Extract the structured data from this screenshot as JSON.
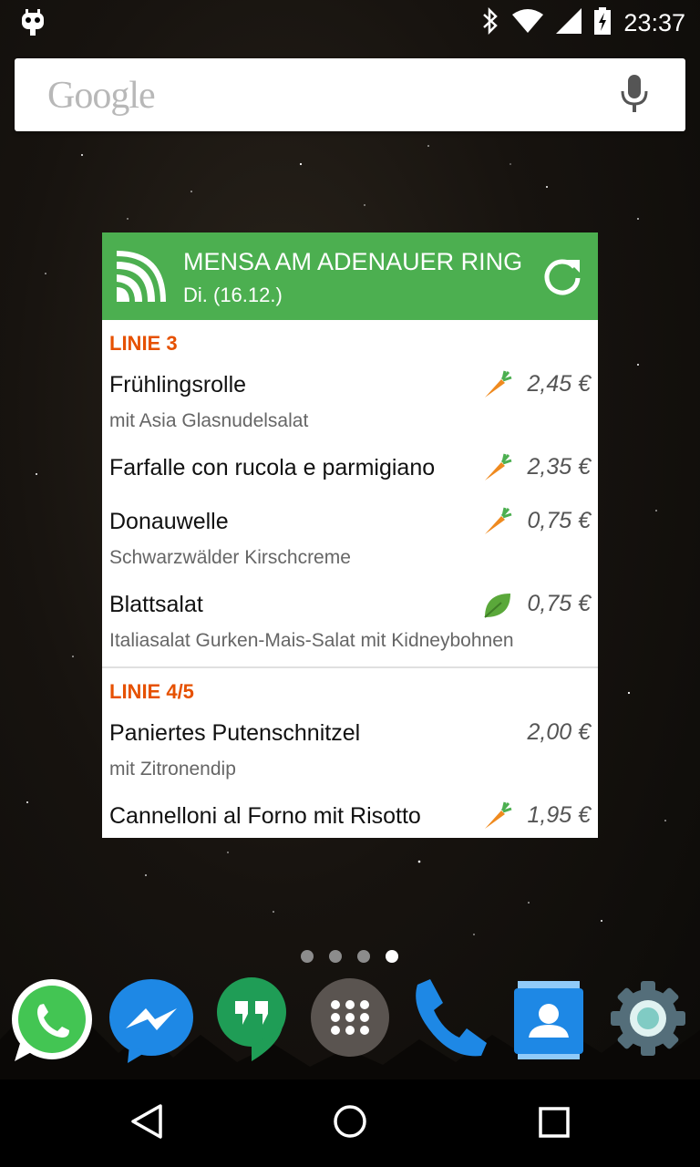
{
  "status_bar": {
    "time": "23:37",
    "icons": [
      "cyanogenmod-icon",
      "bluetooth-icon",
      "wifi-icon",
      "signal-icon",
      "battery-charging-icon"
    ]
  },
  "search": {
    "logo_text": "Google",
    "icon": "mic-icon"
  },
  "widget": {
    "title": "MENSA AM ADENAUER RING",
    "date": "Di. (16.12.)",
    "colors": {
      "header": "#4caf50",
      "line_title": "#e65100"
    },
    "lines": [
      {
        "title": "LINIE 3",
        "meals": [
          {
            "name": "Frühlingsrolle",
            "desc": "mit Asia Glasnudelsalat",
            "price": "2,45 €",
            "icon": "carrot-icon"
          },
          {
            "name": "Farfalle con rucola e parmigiano",
            "desc": "",
            "price": "2,35 €",
            "icon": "carrot-icon"
          },
          {
            "name": "Donauwelle",
            "desc": "Schwarzwälder Kirschcreme",
            "price": "0,75 €",
            "icon": "carrot-icon"
          },
          {
            "name": "Blattsalat",
            "desc": "Italiasalat Gurken-Mais-Salat mit Kidneybohnen",
            "price": "0,75 €",
            "icon": "leaf-icon"
          }
        ]
      },
      {
        "title": "LINIE 4/5",
        "meals": [
          {
            "name": "Paniertes Putenschnitzel",
            "desc": "mit Zitronendip",
            "price": "2,00 €",
            "icon": ""
          },
          {
            "name": "Cannelloni al Forno mit Risotto",
            "desc": "",
            "price": "1,95 €",
            "icon": "carrot-icon"
          }
        ]
      }
    ]
  },
  "home": {
    "pages": 4,
    "active_page": 4,
    "dock": [
      "WhatsApp",
      "Messenger",
      "Hangouts",
      "Apps",
      "Phone",
      "Contacts",
      "Settings"
    ]
  },
  "nav": [
    "back-icon",
    "home-icon",
    "recents-icon"
  ]
}
